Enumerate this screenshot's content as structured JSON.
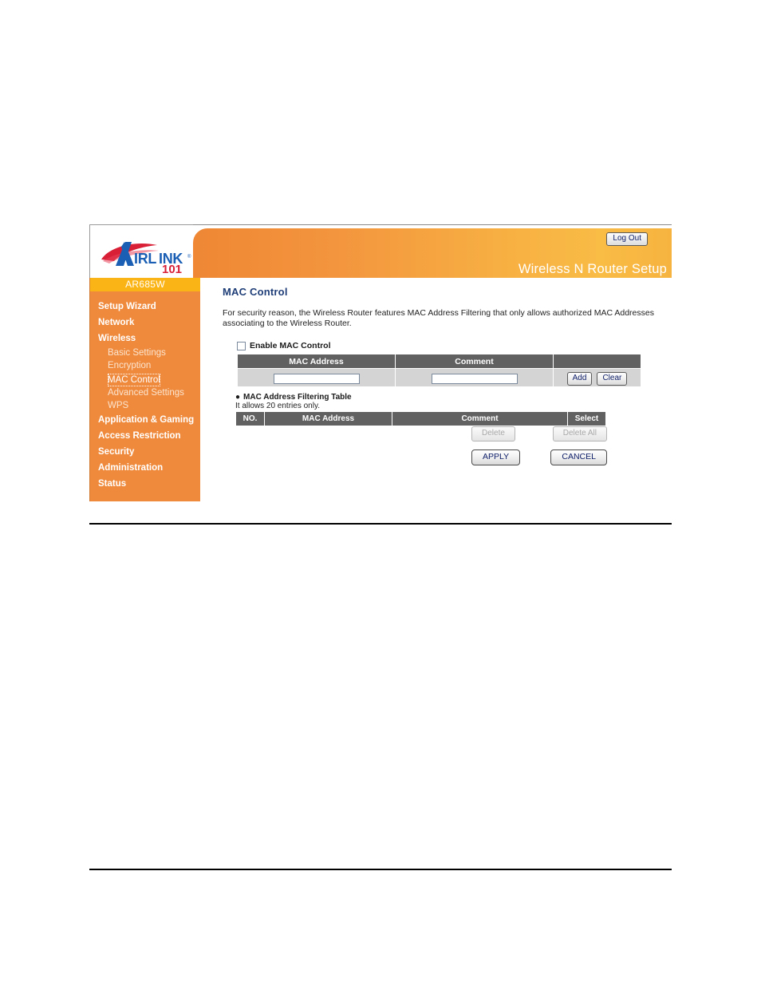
{
  "banner": {
    "title": "Wireless N Router Setup",
    "logout_label": "Log Out",
    "logo_text_primary": "IRLINK",
    "logo_text_secondary": "101",
    "logo_initial": "A",
    "logo_registered": "®"
  },
  "sidebar": {
    "model": "AR685W",
    "items": [
      {
        "label": "Setup Wizard",
        "level": "top"
      },
      {
        "label": "Network",
        "level": "top"
      },
      {
        "label": "Wireless",
        "level": "top"
      },
      {
        "label": "Basic Settings",
        "level": "sub"
      },
      {
        "label": "Encryption",
        "level": "sub"
      },
      {
        "label": "MAC Control",
        "level": "sub",
        "active": true
      },
      {
        "label": "Advanced Settings",
        "level": "sub"
      },
      {
        "label": "WPS",
        "level": "sub"
      },
      {
        "label": "Application & Gaming",
        "level": "top"
      },
      {
        "label": "Access Restriction",
        "level": "top"
      },
      {
        "label": "Security",
        "level": "top"
      },
      {
        "label": "Administration",
        "level": "top"
      },
      {
        "label": "Status",
        "level": "top"
      }
    ]
  },
  "content": {
    "title": "MAC Control",
    "description": "For security reason, the Wireless Router features MAC Address Filtering that only allows authorized MAC Addresses associating to the Wireless Router.",
    "enable_label": "Enable MAC Control",
    "enable_checked": false,
    "entry_form": {
      "headers": [
        "MAC Address",
        "Comment",
        ""
      ],
      "mac_value": "",
      "mac_placeholder": "",
      "comment_value": "",
      "comment_placeholder": "",
      "add_label": "Add",
      "clear_label": "Clear"
    },
    "filter_table": {
      "heading": "MAC Address Filtering Table",
      "subtext": "It allows 20 entries only.",
      "headers": [
        "NO.",
        "MAC Address",
        "Comment",
        "Select"
      ],
      "rows": [],
      "delete_label": "Delete",
      "delete_all_label": "Delete All",
      "delete_enabled": false,
      "delete_all_enabled": false
    },
    "apply_label": "APPLY",
    "cancel_label": "CANCEL"
  },
  "colors": {
    "sidebar_orange": "#ef8a3c",
    "badge_amber": "#fbb415",
    "banner_start": "#ef8735",
    "banner_end": "#f9bc45",
    "table_header_grey": "#616161",
    "title_blue": "#1f3e78",
    "logo_blue": "#1a5fb4",
    "logo_red": "#d81f36"
  }
}
